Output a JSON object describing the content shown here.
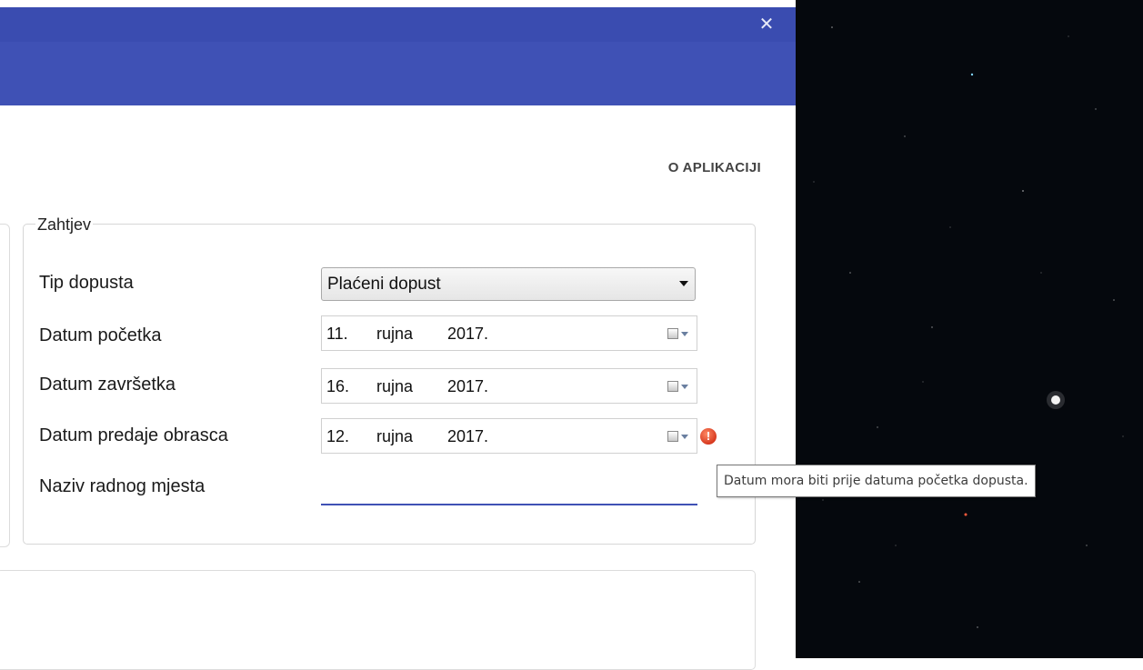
{
  "window": {
    "close_glyph": "✕",
    "header_color": "#3f51b5",
    "titlebar_color": "#3a4cb0"
  },
  "nav": {
    "about_label": "O APLIKACIJI"
  },
  "form": {
    "legend": "Zahtjev",
    "leave_type": {
      "label": "Tip dopusta",
      "selected": "Plaćeni dopust"
    },
    "start_date": {
      "label": "Datum početka",
      "day": "11.",
      "month": "rujna",
      "year": "2017."
    },
    "end_date": {
      "label": "Datum završetka",
      "day": "16.",
      "month": "rujna",
      "year": "2017."
    },
    "submit_date": {
      "label": "Datum predaje obrasca",
      "day": "12.",
      "month": "rujna",
      "year": "2017.",
      "error_icon": "error-icon",
      "error_glyph": "!",
      "error_color": "#d7391f"
    },
    "job_title": {
      "label": "Naziv radnog mjesta",
      "value": ""
    }
  },
  "tooltip": {
    "text": "Datum mora biti prije datuma početka dopusta."
  }
}
